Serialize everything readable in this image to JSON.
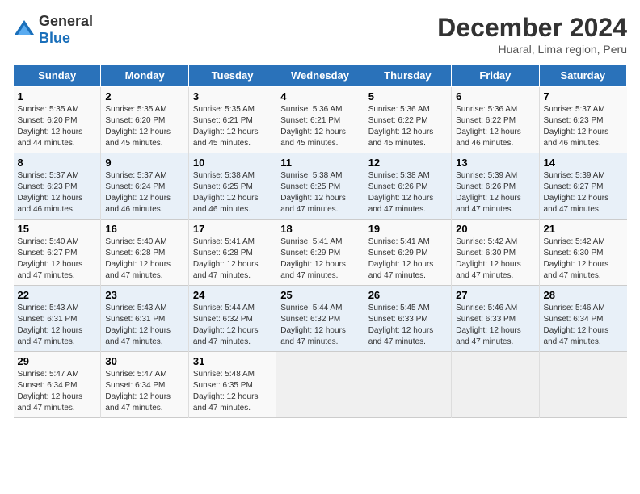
{
  "logo": {
    "text_general": "General",
    "text_blue": "Blue"
  },
  "title": "December 2024",
  "subtitle": "Huaral, Lima region, Peru",
  "days_of_week": [
    "Sunday",
    "Monday",
    "Tuesday",
    "Wednesday",
    "Thursday",
    "Friday",
    "Saturday"
  ],
  "weeks": [
    [
      {
        "day": "1",
        "info": "Sunrise: 5:35 AM\nSunset: 6:20 PM\nDaylight: 12 hours\nand 44 minutes."
      },
      {
        "day": "2",
        "info": "Sunrise: 5:35 AM\nSunset: 6:20 PM\nDaylight: 12 hours\nand 45 minutes."
      },
      {
        "day": "3",
        "info": "Sunrise: 5:35 AM\nSunset: 6:21 PM\nDaylight: 12 hours\nand 45 minutes."
      },
      {
        "day": "4",
        "info": "Sunrise: 5:36 AM\nSunset: 6:21 PM\nDaylight: 12 hours\nand 45 minutes."
      },
      {
        "day": "5",
        "info": "Sunrise: 5:36 AM\nSunset: 6:22 PM\nDaylight: 12 hours\nand 45 minutes."
      },
      {
        "day": "6",
        "info": "Sunrise: 5:36 AM\nSunset: 6:22 PM\nDaylight: 12 hours\nand 46 minutes."
      },
      {
        "day": "7",
        "info": "Sunrise: 5:37 AM\nSunset: 6:23 PM\nDaylight: 12 hours\nand 46 minutes."
      }
    ],
    [
      {
        "day": "8",
        "info": "Sunrise: 5:37 AM\nSunset: 6:23 PM\nDaylight: 12 hours\nand 46 minutes."
      },
      {
        "day": "9",
        "info": "Sunrise: 5:37 AM\nSunset: 6:24 PM\nDaylight: 12 hours\nand 46 minutes."
      },
      {
        "day": "10",
        "info": "Sunrise: 5:38 AM\nSunset: 6:25 PM\nDaylight: 12 hours\nand 46 minutes."
      },
      {
        "day": "11",
        "info": "Sunrise: 5:38 AM\nSunset: 6:25 PM\nDaylight: 12 hours\nand 47 minutes."
      },
      {
        "day": "12",
        "info": "Sunrise: 5:38 AM\nSunset: 6:26 PM\nDaylight: 12 hours\nand 47 minutes."
      },
      {
        "day": "13",
        "info": "Sunrise: 5:39 AM\nSunset: 6:26 PM\nDaylight: 12 hours\nand 47 minutes."
      },
      {
        "day": "14",
        "info": "Sunrise: 5:39 AM\nSunset: 6:27 PM\nDaylight: 12 hours\nand 47 minutes."
      }
    ],
    [
      {
        "day": "15",
        "info": "Sunrise: 5:40 AM\nSunset: 6:27 PM\nDaylight: 12 hours\nand 47 minutes."
      },
      {
        "day": "16",
        "info": "Sunrise: 5:40 AM\nSunset: 6:28 PM\nDaylight: 12 hours\nand 47 minutes."
      },
      {
        "day": "17",
        "info": "Sunrise: 5:41 AM\nSunset: 6:28 PM\nDaylight: 12 hours\nand 47 minutes."
      },
      {
        "day": "18",
        "info": "Sunrise: 5:41 AM\nSunset: 6:29 PM\nDaylight: 12 hours\nand 47 minutes."
      },
      {
        "day": "19",
        "info": "Sunrise: 5:41 AM\nSunset: 6:29 PM\nDaylight: 12 hours\nand 47 minutes."
      },
      {
        "day": "20",
        "info": "Sunrise: 5:42 AM\nSunset: 6:30 PM\nDaylight: 12 hours\nand 47 minutes."
      },
      {
        "day": "21",
        "info": "Sunrise: 5:42 AM\nSunset: 6:30 PM\nDaylight: 12 hours\nand 47 minutes."
      }
    ],
    [
      {
        "day": "22",
        "info": "Sunrise: 5:43 AM\nSunset: 6:31 PM\nDaylight: 12 hours\nand 47 minutes."
      },
      {
        "day": "23",
        "info": "Sunrise: 5:43 AM\nSunset: 6:31 PM\nDaylight: 12 hours\nand 47 minutes."
      },
      {
        "day": "24",
        "info": "Sunrise: 5:44 AM\nSunset: 6:32 PM\nDaylight: 12 hours\nand 47 minutes."
      },
      {
        "day": "25",
        "info": "Sunrise: 5:44 AM\nSunset: 6:32 PM\nDaylight: 12 hours\nand 47 minutes."
      },
      {
        "day": "26",
        "info": "Sunrise: 5:45 AM\nSunset: 6:33 PM\nDaylight: 12 hours\nand 47 minutes."
      },
      {
        "day": "27",
        "info": "Sunrise: 5:46 AM\nSunset: 6:33 PM\nDaylight: 12 hours\nand 47 minutes."
      },
      {
        "day": "28",
        "info": "Sunrise: 5:46 AM\nSunset: 6:34 PM\nDaylight: 12 hours\nand 47 minutes."
      }
    ],
    [
      {
        "day": "29",
        "info": "Sunrise: 5:47 AM\nSunset: 6:34 PM\nDaylight: 12 hours\nand 47 minutes."
      },
      {
        "day": "30",
        "info": "Sunrise: 5:47 AM\nSunset: 6:34 PM\nDaylight: 12 hours\nand 47 minutes."
      },
      {
        "day": "31",
        "info": "Sunrise: 5:48 AM\nSunset: 6:35 PM\nDaylight: 12 hours\nand 47 minutes."
      },
      null,
      null,
      null,
      null
    ]
  ]
}
